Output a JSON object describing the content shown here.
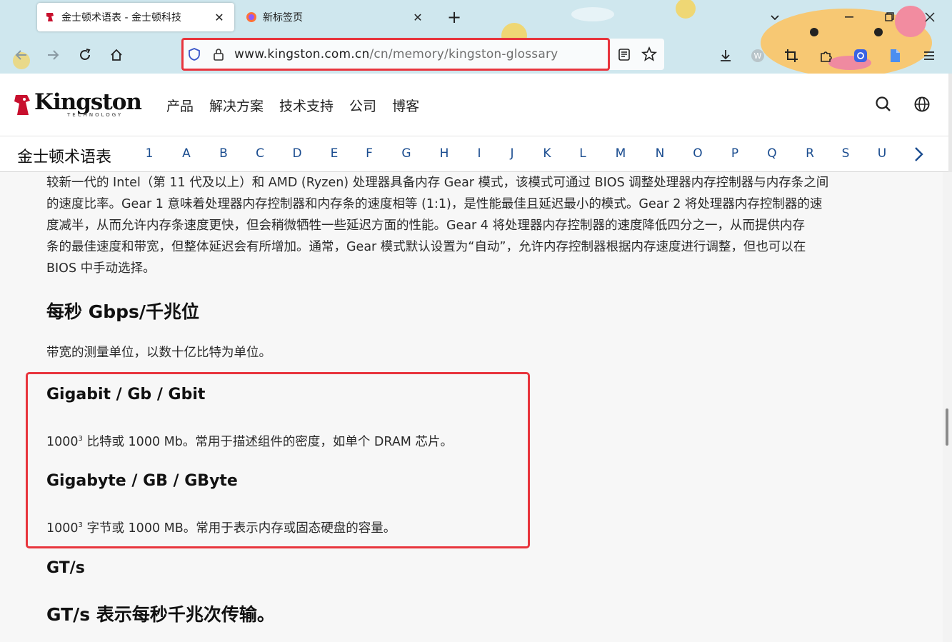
{
  "browser": {
    "tabs": [
      {
        "title": "金士顿术语表 - 金士顿科技",
        "active": true,
        "icon": "kingston-favicon"
      },
      {
        "title": "新标签页",
        "active": false,
        "icon": "firefox-icon"
      }
    ],
    "new_tab_symbol": "+",
    "close_symbol": "✕",
    "url_host": "www.kingston.com.cn",
    "url_path": "/cn/memory/kingston-glossary"
  },
  "site": {
    "brand": "Kingston",
    "brand_sub": "TECHNOLOGY",
    "nav": [
      "产品",
      "解决方案",
      "技术支持",
      "公司",
      "博客"
    ],
    "header_icons": [
      "search-icon",
      "globe-icon"
    ]
  },
  "glossary_bar": {
    "title": "金士顿术语表",
    "letters": [
      "1",
      "A",
      "B",
      "C",
      "D",
      "E",
      "F",
      "G",
      "H",
      "I",
      "J",
      "K",
      "L",
      "M",
      "N",
      "O",
      "P",
      "Q",
      "R",
      "S",
      "U"
    ]
  },
  "article": {
    "intro_lines": [
      "较新一代的 Intel（第 11 代及以上）和 AMD (Ryzen) 处理器具备内存 Gear 模式，该模式可通过 BIOS 调整处理器内存控制器与内存条之间",
      "的速度比率。Gear 1 意味着处理器内存控制器和内存条的速度相等 (1:1)，是性能最佳且延迟最小的模式。Gear 2 将处理器内存控制器的速",
      "度减半，从而允许内存条速度更快，但会稍微牺牲一些延迟方面的性能。Gear 4 将处理器内存控制器的速度降低四分之一，从而提供内存",
      "条的最佳速度和带宽，但整体延迟会有所增加。通常，Gear 模式默认设置为“自动”，允许内存控制器根据内存速度进行调整，但也可以在",
      "BIOS 中手动选择。"
    ],
    "gbps_heading": "每秒 Gbps/千兆位",
    "gbps_desc": "带宽的测量单位，以数十亿比特为单位。",
    "gigabit_heading": "Gigabit / Gb / Gbit",
    "gigabit_base": "1000",
    "gigabit_exp": "3",
    "gigabit_desc": " 比特或 1000 Mb。常用于描述组件的密度，如单个 DRAM 芯片。",
    "gigabyte_heading": "Gigabyte / GB / GByte",
    "gigabyte_base": "1000",
    "gigabyte_exp": "3",
    "gigabyte_desc": " 字节或 1000 MB。常用于表示内存或固态硬盘的容量。",
    "gts_heading": "GT/s",
    "gts_desc_heading": "GT/s 表示每秒千兆次传输。"
  },
  "colors": {
    "highlight": "#e8353d",
    "link": "#1a4c8f",
    "chrome": "#cfe7ee"
  }
}
